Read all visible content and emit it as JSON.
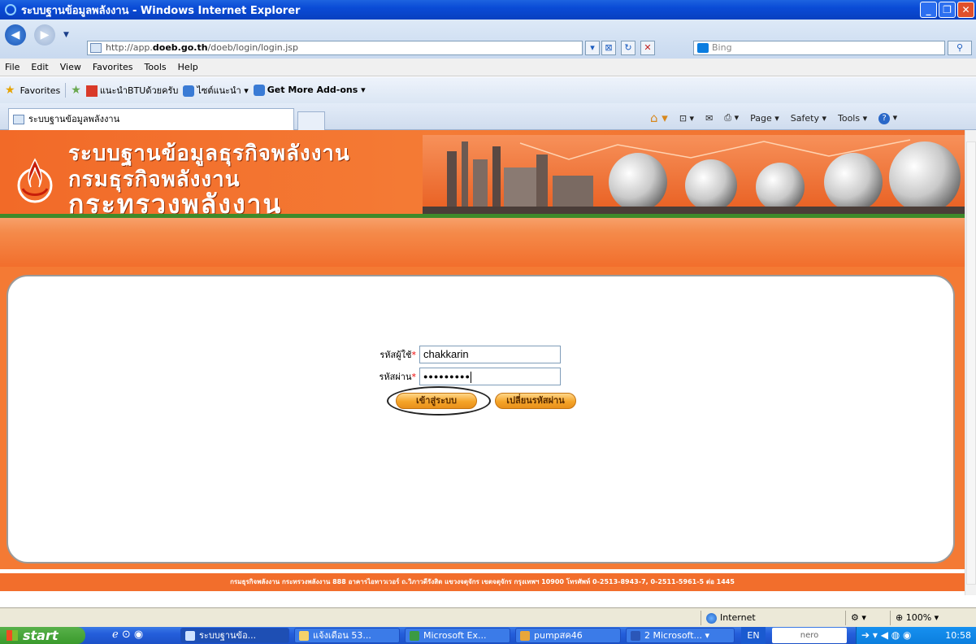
{
  "window": {
    "title": "ระบบฐานข้อมูลพลังงาน - Windows Internet Explorer"
  },
  "address": {
    "url_prefix": "http://app.",
    "url_domain": "doeb.go.th",
    "url_path": "/doeb/login/login.jsp",
    "search_placeholder": "Bing"
  },
  "menu": [
    "File",
    "Edit",
    "View",
    "Favorites",
    "Tools",
    "Help"
  ],
  "favorites_bar": {
    "favorites_label": "Favorites",
    "items": [
      "แนะนำBTUด้วยครับ",
      "ไซต์แนะนำ ▾",
      "Get More Add-ons ▾"
    ]
  },
  "tab": {
    "title": "ระบบฐานข้อมูลพลังงาน"
  },
  "command_bar": {
    "page": "Page ▾",
    "safety": "Safety ▾",
    "tools": "Tools ▾"
  },
  "banner": {
    "line1": "ระบบฐานข้อมูลธุรกิจพลังงาน",
    "line2": "กรมธุรกิจพลังงาน",
    "line3": "กระทรวงพลังงาน"
  },
  "login": {
    "username_label": "รหัสผู้ใช้",
    "username_value": "chakkarin",
    "password_label": "รหัสผ่าน",
    "password_value": "●●●●●●●●●",
    "required_mark": "*",
    "login_button": "เข้าสู่ระบบ",
    "change_password_button": "เปลี่ยนรหัสผ่าน"
  },
  "footer": {
    "text": "กรมธุรกิจพลังงาน กระทรวงพลังงาน 888 อาคารไอทาวเวอร์ ถ.วิภาวดีรังสิต แขวงจตุจักร เขตจตุจักร กรุงเทพฯ 10900 โทรศัพท์ 0-2513-8943-7, 0-2511-5961-5 ต่อ 1445"
  },
  "status_bar": {
    "zone": "Internet",
    "zoom": "100%"
  },
  "taskbar": {
    "start": "start",
    "items": [
      "ระบบฐานข้อ...",
      "แจ้งเดือน 53...",
      "Microsoft Ex...",
      "pumpสค46",
      "2 Microsoft..."
    ],
    "lang": "EN",
    "nero": "nero",
    "clock": "10:58"
  },
  "colors": {
    "banner_orange": "#f26e2c",
    "ie_blue": "#0a4bd6",
    "button_orange": "#f5a428",
    "required_red": "#e00000"
  }
}
